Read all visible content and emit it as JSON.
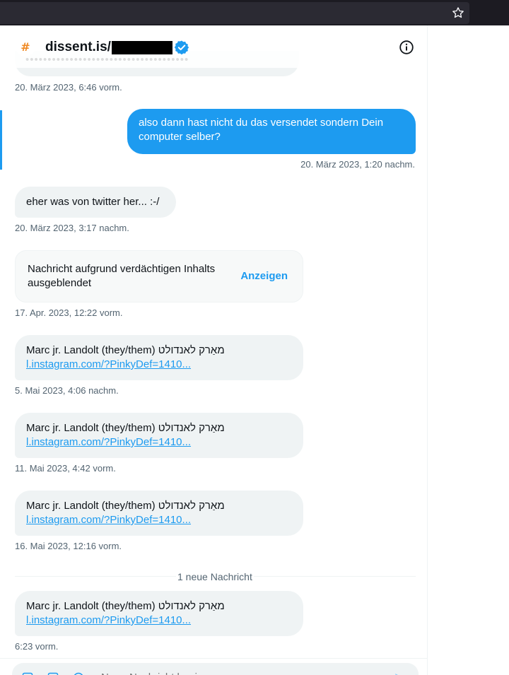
{
  "browser": {
    "bookmark_icon": "star-icon"
  },
  "header": {
    "avatar_symbol": "#",
    "title": "dissent.is/",
    "verified_icon": "verified-badge-icon",
    "info_icon": "info-icon"
  },
  "messages": [
    {
      "id": "m0",
      "direction": "in",
      "partial": true,
      "time": "20. März 2023, 6:46 vorm."
    },
    {
      "id": "m1",
      "direction": "out",
      "text_line1": "also dann hast nicht du das versendet sondern Dein",
      "text_line2": "computer selber?",
      "time": "20. März 2023, 1:20 nachm."
    },
    {
      "id": "m2",
      "direction": "in",
      "text": "eher was von twitter her... :-/",
      "time": "20. März 2023, 3:17 nachm."
    },
    {
      "id": "m3",
      "direction": "in",
      "hidden": true,
      "text_line1": "Nachricht aufgrund verdächtigen Inhalts",
      "text_line2": "ausgeblendet",
      "action": "Anzeigen",
      "time": "17. Apr. 2023, 12:22 vorm."
    },
    {
      "id": "m4",
      "direction": "in",
      "text": "Marc jr. Landolt (they/them) מאַרק לאנדולט",
      "link": "l.instagram.com/?PinkyDef=1410...",
      "time": "5. Mai 2023, 4:06 nachm."
    },
    {
      "id": "m5",
      "direction": "in",
      "text": "Marc jr. Landolt (they/them) מאַרק לאנדולט",
      "link": "l.instagram.com/?PinkyDef=1410...",
      "time": "11. Mai 2023, 4:42 vorm."
    },
    {
      "id": "m6",
      "direction": "in",
      "text": "Marc jr. Landolt (they/them) מאַרק לאנדולט",
      "link": "l.instagram.com/?PinkyDef=1410...",
      "time": "16. Mai 2023, 12:16 vorm."
    },
    {
      "id": "m7",
      "direction": "in",
      "text": "Marc jr. Landolt (they/them) מאַרק לאנדולט",
      "link": "l.instagram.com/?PinkyDef=1410...",
      "time": "6:23 vorm."
    }
  ],
  "divider": {
    "label": "1 neue Nachricht"
  },
  "composer": {
    "placeholder": "Neue Nachricht beginnen",
    "icons": [
      "image-icon",
      "gif-icon",
      "emoji-icon",
      "send-icon"
    ]
  },
  "colors": {
    "accent": "#1d9bf0",
    "bubble_in": "#eff3f4",
    "text": "#0f1419",
    "muted": "#536471"
  }
}
